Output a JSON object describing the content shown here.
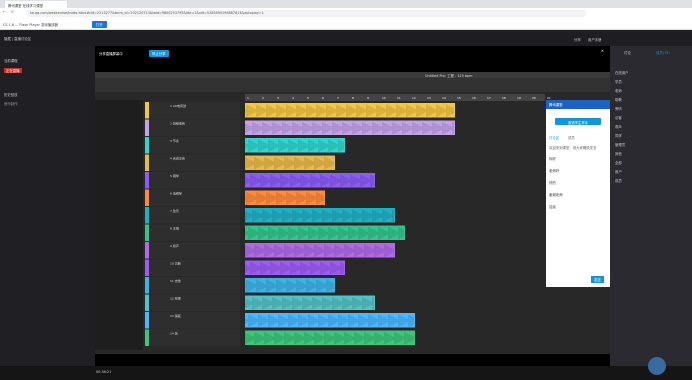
{
  "browser": {
    "tab_title": "腾讯课堂 在线学习课堂",
    "url": "ke.qq.com/webcourse/index.html#cid=2213277&term_id=102120713&taid=9800253795&lite=1&vid=5285890196887813&autoplay=1"
  },
  "bookmarks": {
    "item1": "CS 1.6 ... Flash Player 游戏播放器",
    "open_button": "打开"
  },
  "page": {
    "left_header": "隐藏 | 直播讨论区",
    "left_title1": "当前课程",
    "left_title2": "历史回放",
    "left_status": "正在直播",
    "course_name": "音乐制作",
    "top_right": [
      "分享",
      "用户手册"
    ],
    "pagination": "1/23"
  },
  "modal": {
    "title": "分享直播屏幕中",
    "button": "停止分享"
  },
  "daw": {
    "tracks": [
      "1 AR电音鼓",
      "2 鼓组低音",
      "3 节奏",
      "4 合成主音",
      "5 钢琴",
      "6 电钢琴",
      "7 弦乐",
      "8 主唱",
      "9 和声",
      "10 贝斯",
      "11 吉他",
      "12 效果",
      "13 铺底",
      "14 鼓"
    ],
    "ruler": [
      "1",
      "2",
      "3",
      "4",
      "5",
      "6",
      "7",
      "8",
      "9",
      "10",
      "11",
      "12",
      "13",
      "14",
      "15",
      "16",
      "17",
      "18",
      "19",
      "20",
      "21"
    ],
    "toolbar": "Untitled Pro: 工程 - 125 bpm",
    "colors": [
      "#f2c744",
      "#c3a2e8",
      "#2fd6d0",
      "#e7b94a",
      "#8b5cf6",
      "#ff8a3d",
      "#1fb1c3",
      "#31c48d",
      "#b06ae6",
      "#9d5cf5",
      "#3cb3e6",
      "#54c1c7",
      "#4ab8ff",
      "#3cc77a"
    ]
  },
  "chat": {
    "logo": "腾讯课堂",
    "start_button": "邀请学生举手",
    "tabs": [
      "讨论区",
      "成员"
    ],
    "messages": [
      "欢迎来到课堂，请大家踊跃发言",
      "你好",
      "老师好",
      "好的",
      "谢谢老师",
      "加油"
    ],
    "send": "发送"
  },
  "rightpanel": {
    "tabs": [
      "讨论",
      "成员(79)"
    ],
    "items": [
      "在线用户",
      "学员",
      "老师",
      "助教",
      "旁听",
      "访客",
      "观众",
      "同学",
      "管理员",
      "其他",
      "全部",
      "用户",
      "成员"
    ]
  },
  "bottom": {
    "time": "00:38:21"
  }
}
